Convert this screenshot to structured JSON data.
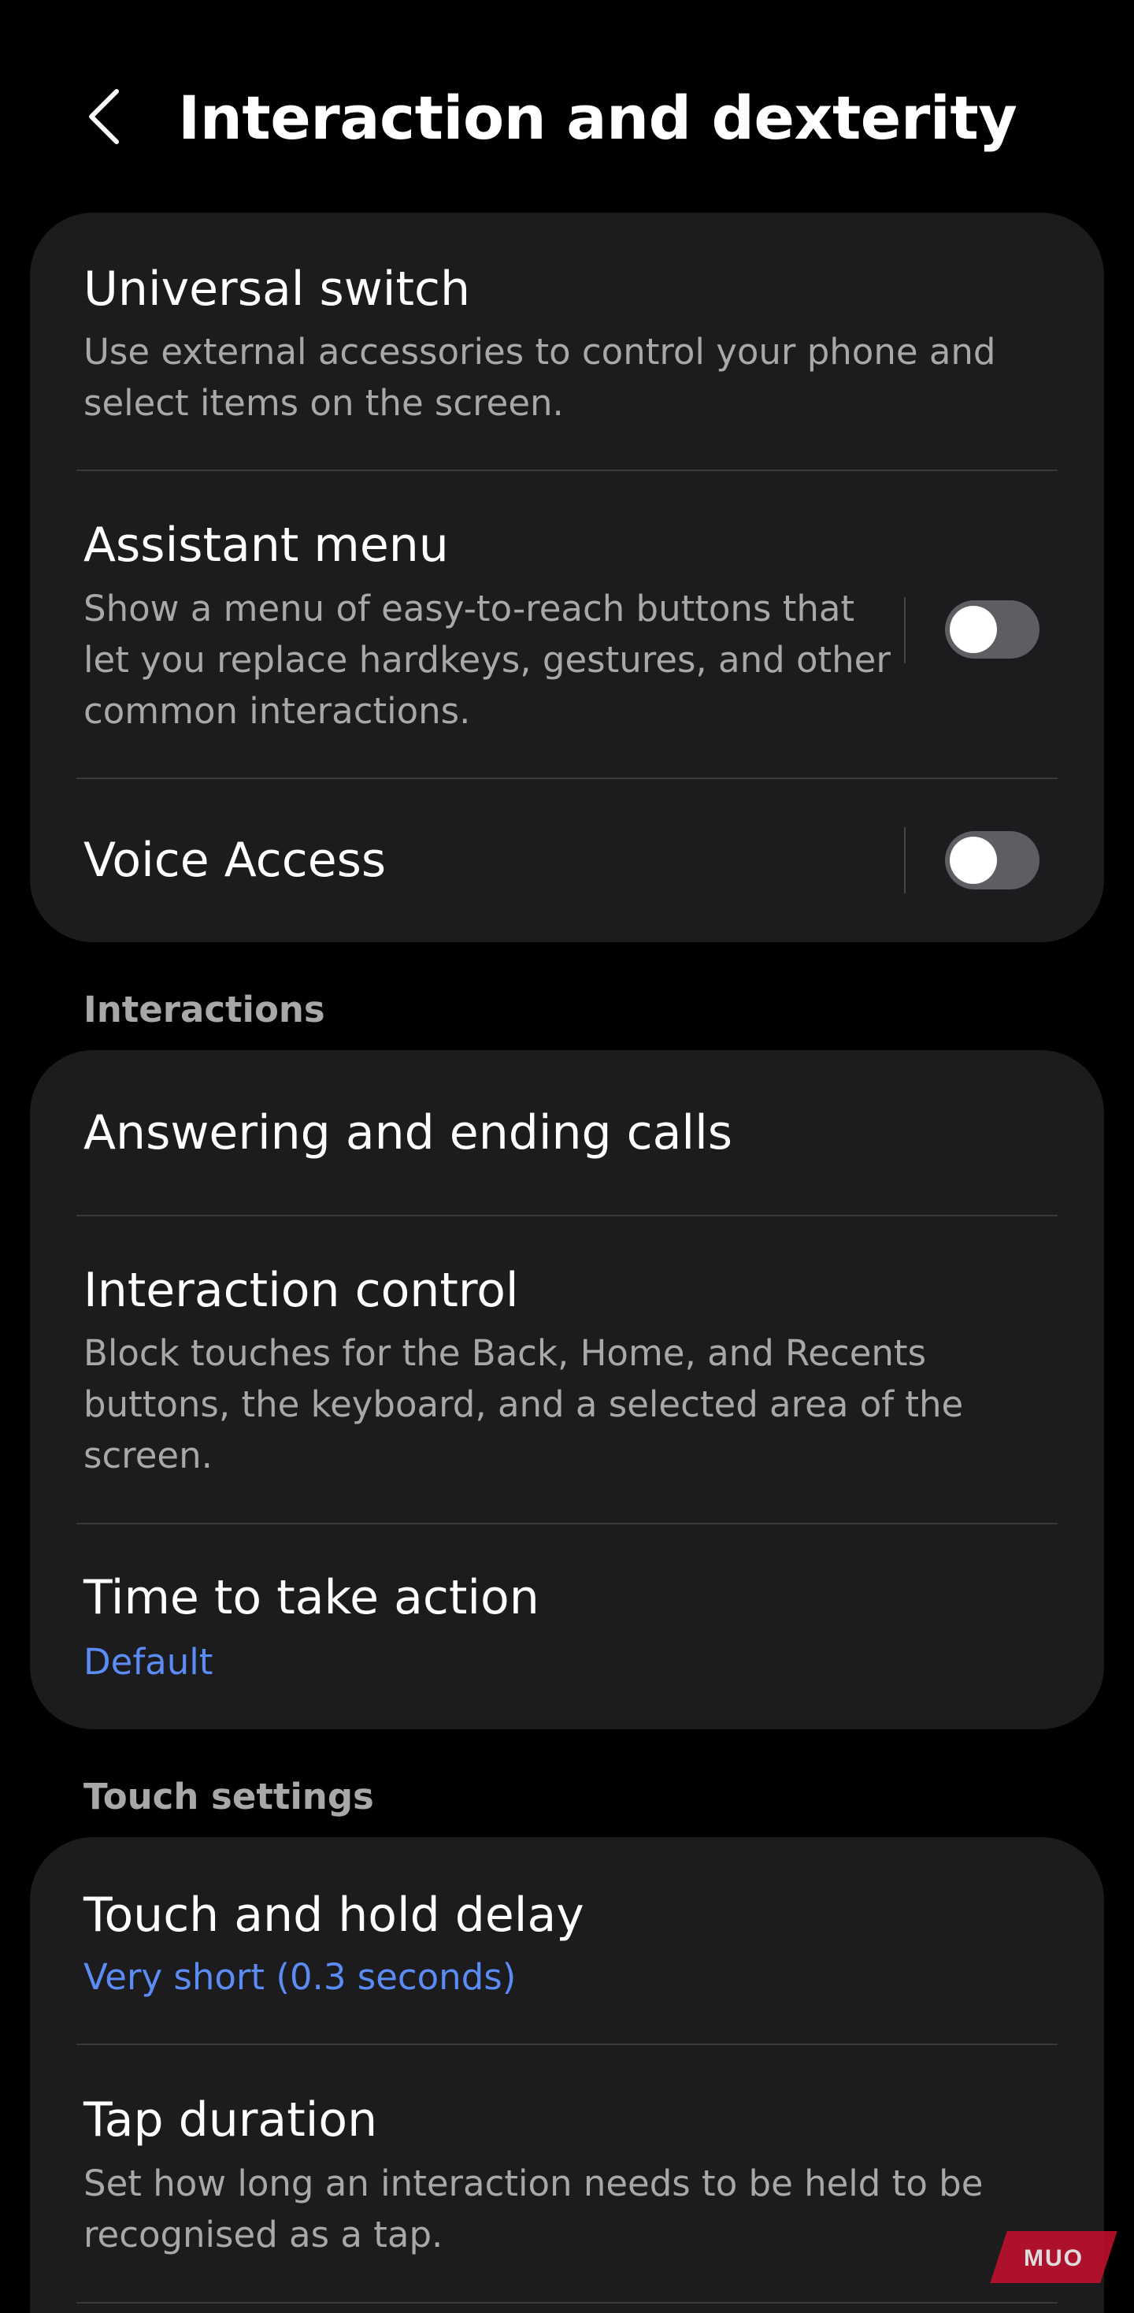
{
  "header": {
    "title": "Interaction and dexterity"
  },
  "card1": {
    "universal_switch": {
      "title": "Universal switch",
      "desc_line1": "Use external accessories to control your phone and",
      "desc_line2": "select items on the screen."
    },
    "assistant_menu": {
      "title": "Assistant menu",
      "desc_line1": "Show a menu of easy-to-reach buttons that",
      "desc_line2": "let you replace hardkeys, gestures, and other",
      "desc_line3": "common interactions.",
      "toggle_on": false
    },
    "voice_access": {
      "title": "Voice Access",
      "toggle_on": false
    }
  },
  "sections": {
    "interactions": "Interactions",
    "touch_settings": "Touch settings"
  },
  "card2": {
    "answering_calls": {
      "title": "Answering and ending calls"
    },
    "interaction_control": {
      "title": "Interaction control",
      "desc_line1": "Block touches for the Back, Home, and Recents",
      "desc_line2": "buttons, the keyboard, and a selected area of the",
      "desc_line3": "screen."
    },
    "time_to_take_action": {
      "title": "Time to take action",
      "value": "Default"
    }
  },
  "card3": {
    "touch_hold_delay": {
      "title": "Touch and hold delay",
      "value": "Very short (0.3 seconds)"
    },
    "tap_duration": {
      "title": "Tap duration",
      "desc_line1": "Set how long an interaction needs to be held to be",
      "desc_line2": "recognised as a tap."
    }
  },
  "watermark": {
    "text": "MUO"
  },
  "icons": {
    "back": "chevron-left-icon"
  },
  "colors": {
    "background": "#000000",
    "card": "#1c1c1e",
    "accent_value": "#5b8cf5",
    "secondary_text": "#a8a8aa",
    "toggle_off_track": "#5d5d62",
    "watermark": "#c8102e"
  }
}
